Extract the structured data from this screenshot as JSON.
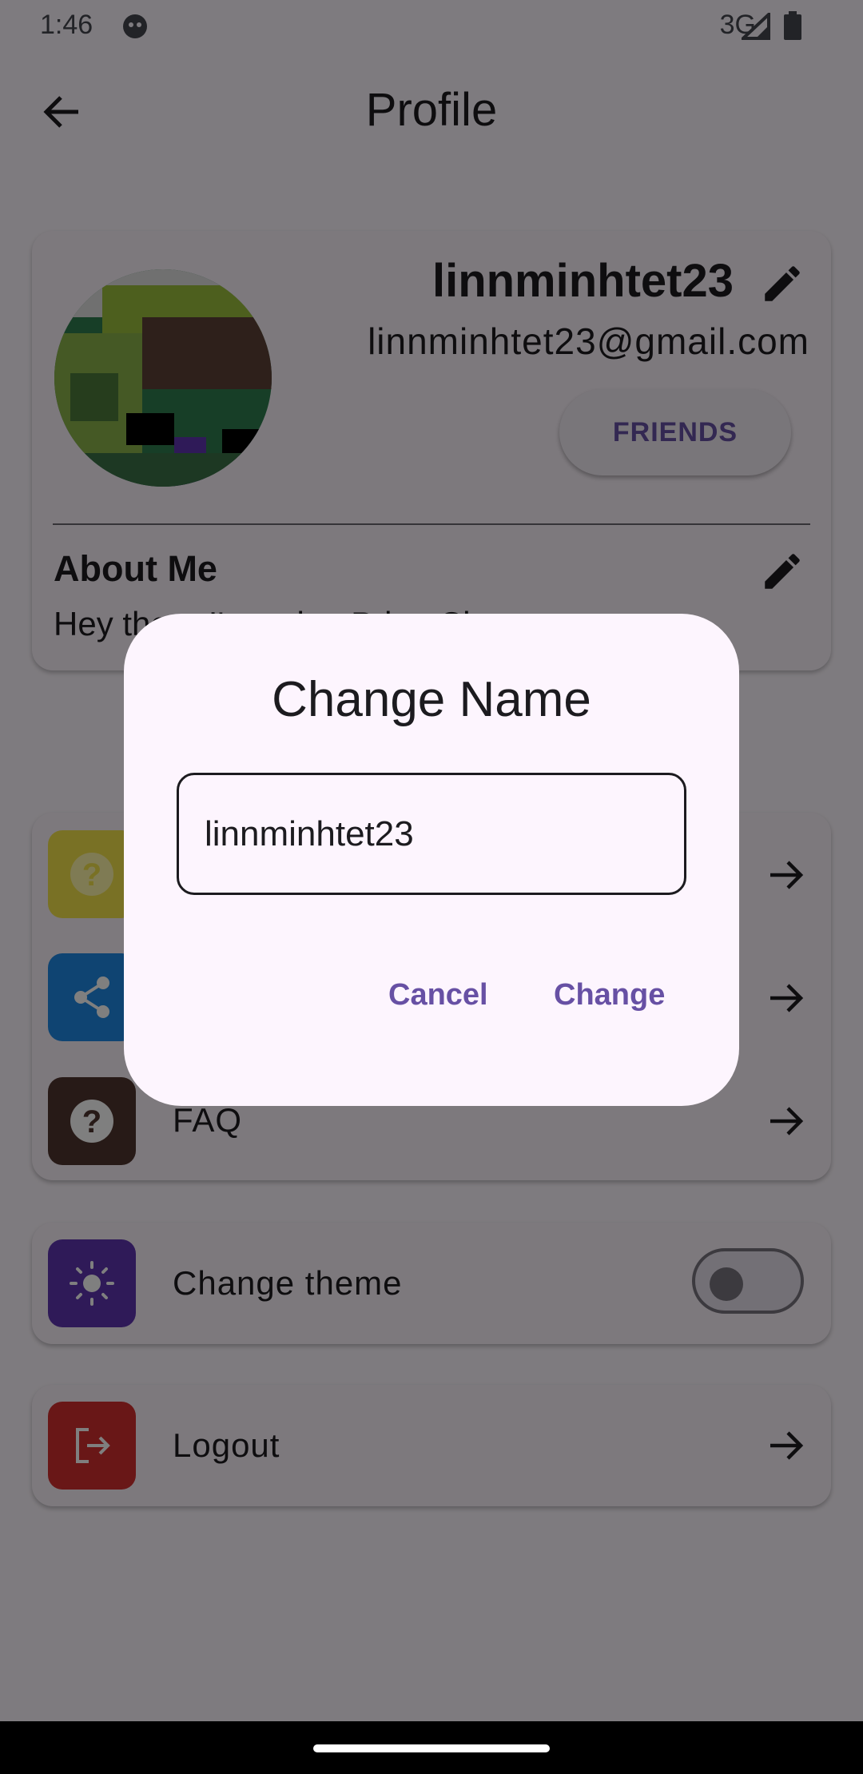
{
  "status_bar": {
    "time": "1:46",
    "network": "3G"
  },
  "app_bar": {
    "title": "Profile"
  },
  "profile": {
    "username": "linnminhtet23",
    "email": "linnminhtet23@gmail.com",
    "friends_label": "FRIENDS",
    "about_title": "About Me",
    "about_text": "Hey there I'm using PrimeChat"
  },
  "menu": {
    "items": [
      {
        "label": "FAQ",
        "icon": "question-circle-icon",
        "color": "#4e342e"
      },
      {
        "label": "Change theme",
        "icon": "sun-icon",
        "color": "#5e35b1",
        "toggle_on": false
      },
      {
        "label": "Logout",
        "icon": "logout-icon",
        "color": "#d32f2f"
      }
    ],
    "hidden_icons": [
      {
        "icon": "help-icon",
        "color": "#f3e24a"
      },
      {
        "icon": "share-icon",
        "color": "#1e88e5"
      }
    ]
  },
  "dialog": {
    "title": "Change Name",
    "input_value": "linnminhtet23",
    "cancel_label": "Cancel",
    "change_label": "Change"
  },
  "colors": {
    "accent": "#6750a4",
    "scrim": "rgba(0,0,0,0.5)",
    "dialog_bg": "#fdf5fe"
  }
}
